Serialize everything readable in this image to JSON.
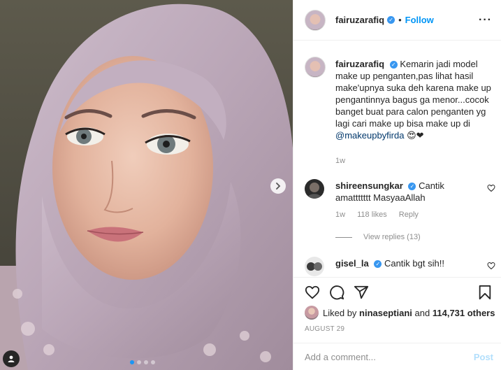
{
  "post": {
    "author": {
      "username": "fairuzarafiq",
      "verified": true,
      "follow_label": "Follow",
      "separator": "•"
    },
    "more_label": "···",
    "media": {
      "carousel_dots": 4,
      "active_dot": 0
    },
    "caption": {
      "username": "fairuzarafiq",
      "text": "Kemarin jadi model make up penganten,pas lihat hasil make'upnya suka deh karena make up pengantinnya bagus ga menor...cocok banget buat para calon penganten yg lagi cari make up bisa make up di",
      "mention": "@makeupbyfirda",
      "emoji": "😍❤",
      "time": "1w"
    },
    "comments": [
      {
        "username": "shireensungkar",
        "verified": true,
        "text": "Cantik amattttttt MasyaaAllah",
        "time": "1w",
        "likes": "118 likes",
        "reply_label": "Reply",
        "view_replies": "View replies (13)"
      },
      {
        "username": "gisel_la",
        "verified": true,
        "text": "Cantik bgt sih!!"
      }
    ],
    "likes": {
      "liked_by_prefix": "Liked by",
      "liked_by_user": "ninaseptiani",
      "and_word": "and",
      "others": "114,731 others"
    },
    "date": "AUGUST 29",
    "add_comment": {
      "placeholder": "Add a comment...",
      "post_label": "Post"
    }
  },
  "colors": {
    "link": "#0095f6",
    "verified": "#3897f0",
    "muted": "#8e8e8e",
    "post_disabled": "#b2dffc"
  }
}
